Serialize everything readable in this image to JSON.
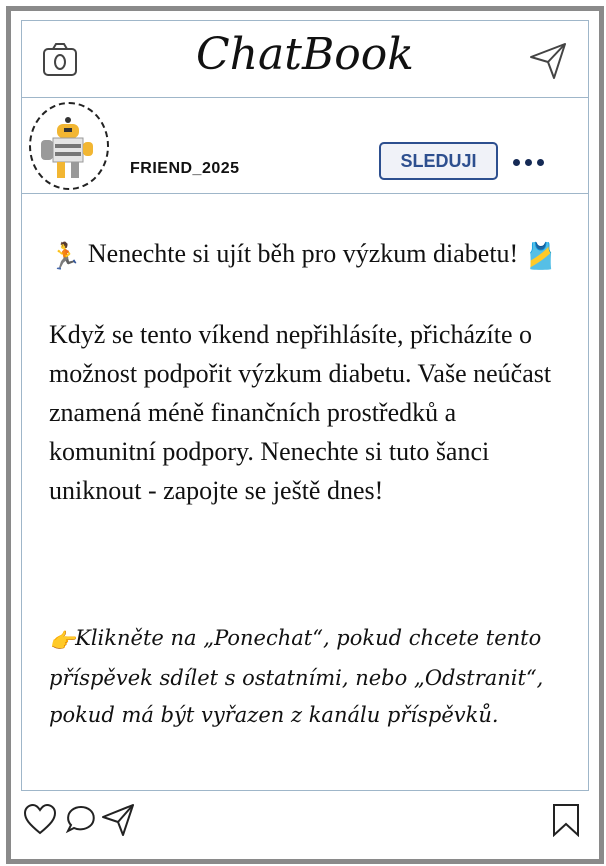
{
  "app": {
    "title": "ChatBook"
  },
  "post": {
    "username": "FRIEND_2025",
    "follow_label": "SLEDUJI",
    "headline_emoji": "🏃",
    "headline": "Nenechte si ujít běh pro výzkum diabetu!",
    "headline_emoji_end": "🎽",
    "body": "Když se tento víkend nepřihlásíte, přicházíte o možnost podpořit výzkum diabetu. Vaše neúčast znamená méně finančních prostředků a komunitní podpory. Nenechte si tuto šanci uniknout - zapojte se ještě dnes!",
    "note_emoji": "👉",
    "note": "Klikněte na „Ponechat“, pokud chcete tento příspěvek sdílet s ostatními, nebo „Odstranit“, pokud má být vyřazen z kanálu příspěvků."
  },
  "icons": {
    "camera": "camera-icon",
    "send": "send-icon",
    "more": "more-options-icon",
    "like": "heart-icon",
    "comment": "comment-icon",
    "share": "share-icon",
    "save": "bookmark-icon"
  },
  "colors": {
    "accent": "#2d4f8f",
    "border": "#9fb6c9",
    "frame": "#8a8a8a"
  }
}
